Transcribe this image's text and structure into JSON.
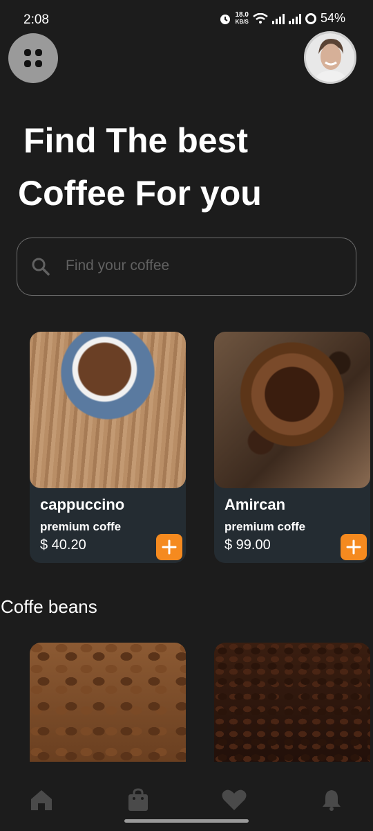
{
  "status_bar": {
    "time": "2:08",
    "net_speed_value": "18.0",
    "net_speed_unit": "KB/S",
    "battery": "54%"
  },
  "header": {
    "title_line1": "Find The best",
    "title_line2": "Coffee For you"
  },
  "search": {
    "placeholder": "Find your coffee",
    "value": ""
  },
  "products": [
    {
      "name": "cappuccino",
      "subtitle": "premium coffe",
      "price": "$ 40.20",
      "add_icon": "plus-icon"
    },
    {
      "name": "Amircan",
      "subtitle": "premium coffe",
      "price": "$ 99.00",
      "add_icon": "plus-icon"
    }
  ],
  "beans_section": {
    "title": "Coffe beans"
  },
  "bottom_nav": {
    "items": [
      "home-icon",
      "bag-icon",
      "heart-icon",
      "bell-icon"
    ]
  },
  "colors": {
    "background": "#1c1c1c",
    "card": "#242c32",
    "accent": "#f58a1f",
    "nav_icon": "#4a4a4a"
  }
}
